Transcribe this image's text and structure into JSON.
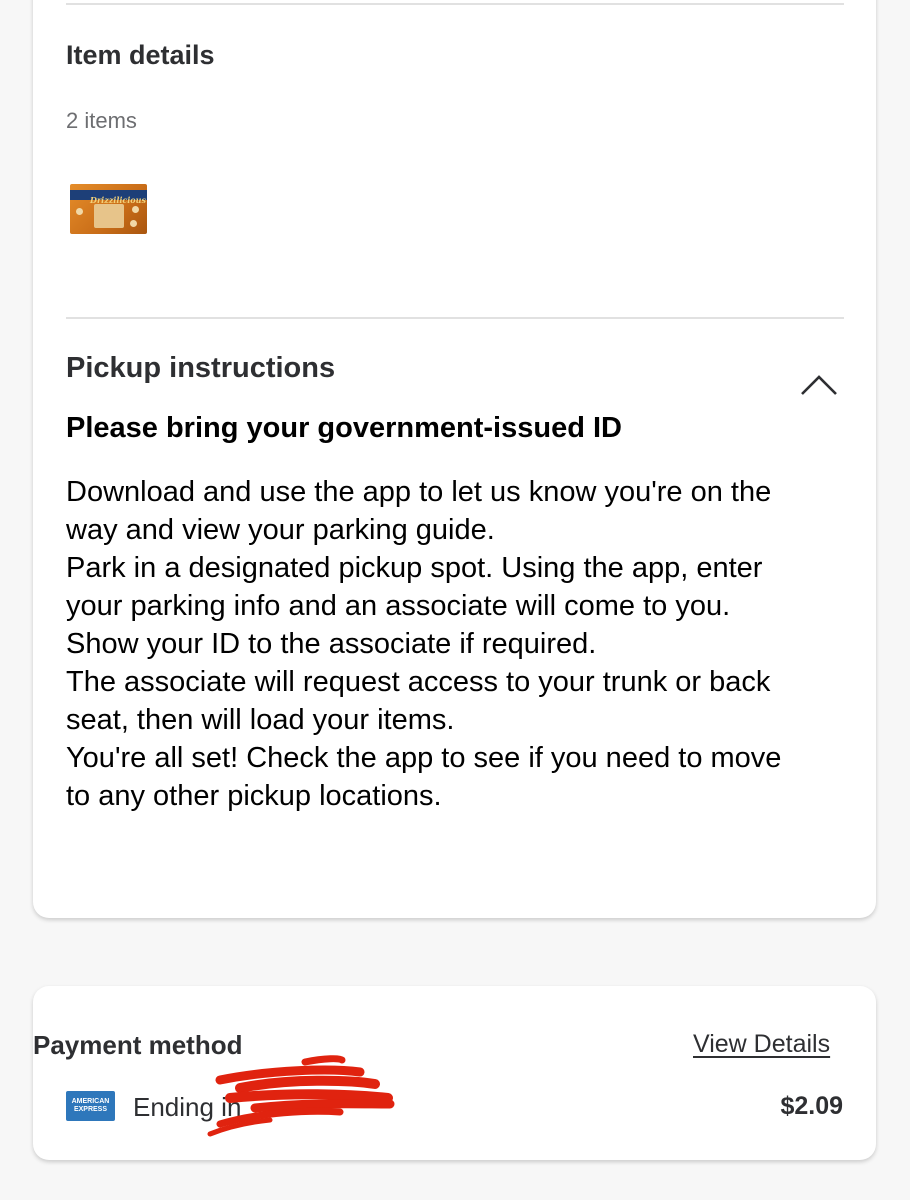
{
  "item_details": {
    "title": "Item details",
    "count": "2 items",
    "product_brand": "Drizzilicious"
  },
  "pickup": {
    "title": "Pickup instructions",
    "subheading": "Please bring your government-issued ID",
    "lines": [
      "Download and use the app to let us know you're on the",
      "way and view your parking guide.",
      "Park in a designated pickup spot. Using the app, enter",
      "your parking info and an associate will come to you.",
      "Show your ID to the associate if required.",
      "The associate will request access to your trunk or back",
      "seat, then will load your items.",
      "You're all set! Check the app to see if you need to move",
      "to any other pickup locations."
    ]
  },
  "payment": {
    "title": "Payment method",
    "view_details": "View Details",
    "card_logo": [
      "AMERICAN",
      "EXPRESS"
    ],
    "ending_text": "Ending in",
    "amount": "$2.09"
  },
  "icons": {
    "chevron": "chevron-up-icon",
    "card": "amex-card-icon"
  },
  "colors": {
    "redaction": "#e0230f",
    "amex_blue": "#2e77bb",
    "background": "#f7f7f7"
  }
}
